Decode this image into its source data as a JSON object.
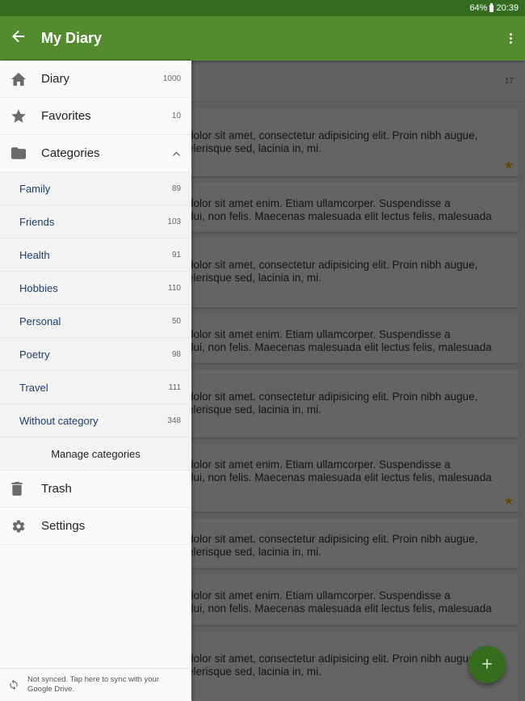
{
  "status_bar": {
    "battery": "64%",
    "time": "20:39"
  },
  "app_bar": {
    "title": "My Diary",
    "back_icon": "arrow-back-icon",
    "menu_icon": "more-vert-icon"
  },
  "drawer": {
    "main_items": [
      {
        "label": "Diary",
        "count": "1000",
        "icon": "home-icon"
      },
      {
        "label": "Favorites",
        "count": "10",
        "icon": "star-icon"
      },
      {
        "label": "Categories",
        "icon": "folder-icon",
        "expanded": true
      }
    ],
    "categories": [
      {
        "label": "Family",
        "count": "89"
      },
      {
        "label": "Friends",
        "count": "103"
      },
      {
        "label": "Health",
        "count": "91"
      },
      {
        "label": "Hobbies",
        "count": "110"
      },
      {
        "label": "Personal",
        "count": "50"
      },
      {
        "label": "Poetry",
        "count": "98"
      },
      {
        "label": "Travel",
        "count": "111"
      },
      {
        "label": "Without category",
        "count": "348"
      }
    ],
    "manage_label": "Manage categories",
    "bottom_items": [
      {
        "label": "Trash",
        "icon": "trash-icon"
      },
      {
        "label": "Settings",
        "icon": "gear-icon"
      }
    ],
    "sync_text": "Not synced. Tap here to sync with your Google Drive."
  },
  "list": {
    "header_count": "17",
    "entries": [
      {
        "line1": "dolor sit amet, consectetur adipisicing elit. Proin nibh augue,",
        "line2": "elerisque sed, lacinia in, mi.",
        "favorite": true
      },
      {
        "line1": "dolor sit amet enim. Etiam ullamcorper. Suspendisse a",
        "line2": "dui, non felis. Maecenas malesuada elit lectus felis, malesuada",
        "favorite": false
      },
      {
        "line1": "dolor sit amet, consectetur adipisicing elit. Proin nibh augue,",
        "line2": "elerisque sed, lacinia in, mi.",
        "favorite": false
      },
      {
        "line1": "dolor sit amet enim. Etiam ullamcorper. Suspendisse a",
        "line2": "dui, non felis. Maecenas malesuada elit lectus felis, malesuada",
        "favorite": false
      },
      {
        "line1": "dolor sit amet, consectetur adipisicing elit. Proin nibh augue,",
        "line2": "elerisque sed, lacinia in, mi.",
        "favorite": false
      },
      {
        "line1": "dolor sit amet enim. Etiam ullamcorper. Suspendisse a",
        "line2": "dui, non felis. Maecenas malesuada elit lectus felis, malesuada",
        "favorite": true
      },
      {
        "line1": "dolor sit amet, consectetur adipisicing elit. Proin nibh augue,",
        "line2": "elerisque sed, lacinia in, mi.",
        "favorite": false
      },
      {
        "line1": "dolor sit amet enim. Etiam ullamcorper. Suspendisse a",
        "line2": "dui, non felis. Maecenas malesuada elit lectus felis, malesuada",
        "favorite": false
      },
      {
        "line1": "dolor sit amet, consectetur adipisicing elit. Proin nibh augue,",
        "line2": "elerisque sed, lacinia in, mi.",
        "favorite": false
      }
    ]
  },
  "fab": {
    "label": "+",
    "icon": "add-icon"
  },
  "colors": {
    "primary": "#548b2f",
    "primary_dark": "#336b1f",
    "fab": "#356d1d",
    "category_text": "#1b3e6a",
    "favorite_star": "#f0b400"
  }
}
